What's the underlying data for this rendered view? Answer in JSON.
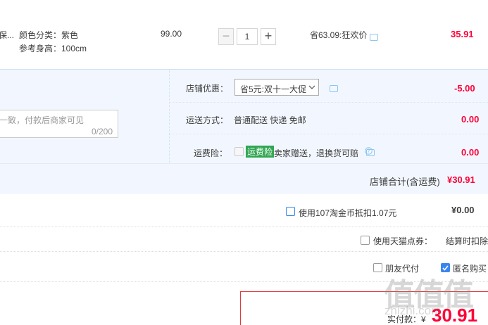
{
  "item": {
    "title_fragment": "保...",
    "spec_color": "颜色分类：紫色",
    "spec_height": "参考身高：100cm",
    "unit_price": "99.00",
    "quantity": "1",
    "discount_text": "省63.09:狂欢价",
    "subtotal": "35.91"
  },
  "shop": {
    "promo_label": "店铺优惠：",
    "promo_select": "省5元:双十一大促",
    "promo_amount": "-5.00",
    "message_placeholder": "一致，付款后商家可见",
    "message_counter": "0/200",
    "shipping_label": "运送方式：",
    "shipping_value": "普通配送 快递 免邮",
    "shipping_amount": "0.00",
    "insurance_label": "运费险：",
    "insurance_badge": "运费险",
    "insurance_text": "卖家赠送，退换货可赔",
    "insurance_amount": "0.00",
    "total_label": "店铺合计(含运费)",
    "total_value": "¥30.91"
  },
  "payment_options": {
    "taojinbi_label": "使用107淘金币抵扣1.07元",
    "taojinbi_amount": "¥0.00",
    "tmall_coupon_label": "使用天猫点券：",
    "tmall_coupon_note": "结算时扣除",
    "friend_pay_label": "朋友代付",
    "anonymous_label": "匿名购买"
  },
  "footer": {
    "actual_pay_label": "实付款：¥",
    "actual_pay_value": "30.91"
  },
  "watermark": {
    "chars": "值值值",
    "domain": "zhizhi.com"
  },
  "colors": {
    "accent_red": "#ff0036",
    "shop_bg": "#f2f7ff",
    "badge_green": "#31a653",
    "checkbox_blue": "#3a86f0"
  }
}
